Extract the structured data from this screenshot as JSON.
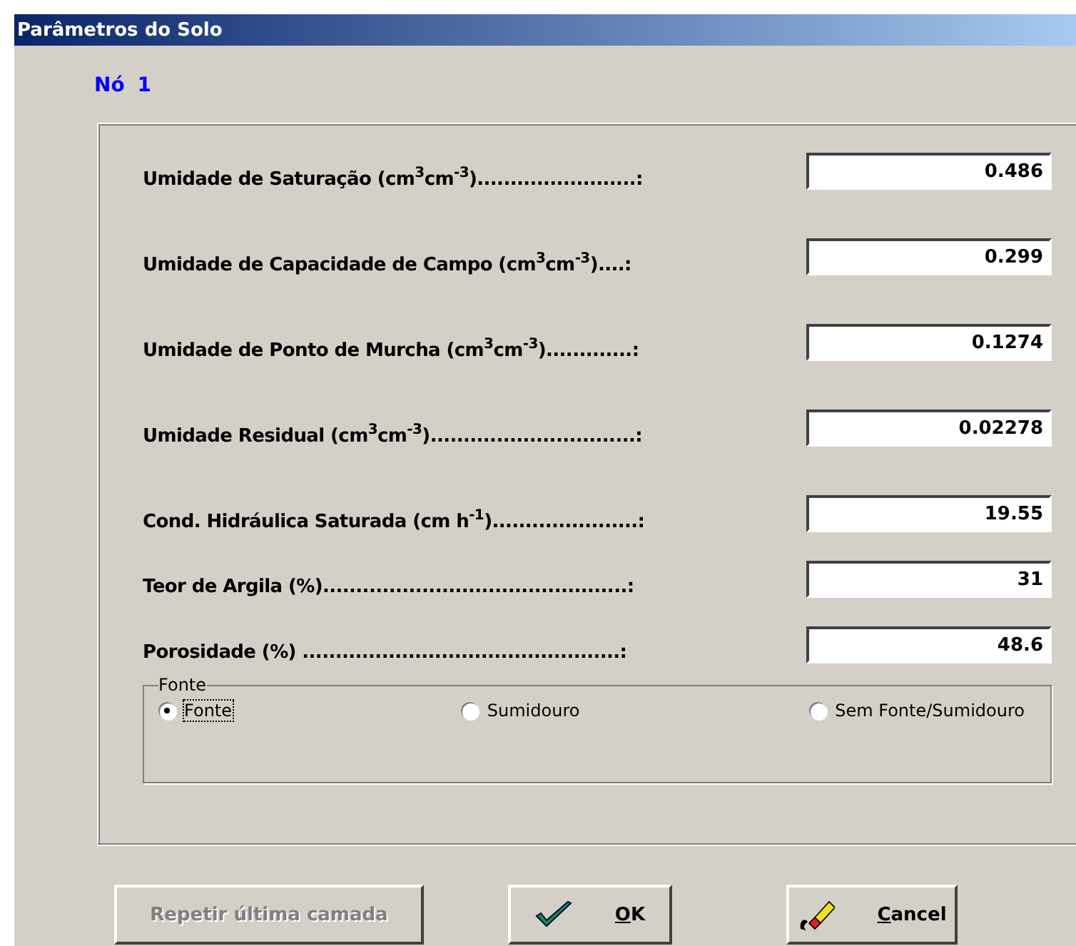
{
  "window": {
    "title": "Parâmetros do Solo"
  },
  "node_label": "Nó 1",
  "fields": [
    {
      "label": "Umidade de Saturação (cm$^{3}$cm$^{-3}$)........................:",
      "value": "0.486"
    },
    {
      "label": "Umidade de Capacidade de Campo (cm$^{3}$cm$^{-3}$)....:",
      "value": "0.299"
    },
    {
      "label": "Umidade de Ponto de Murcha (cm$^{3}$cm$^{-3}$).............:",
      "value": "0.1274"
    },
    {
      "label": "Umidade Residual (cm$^{3}$cm$^{-3}$)...............................:",
      "value": "0.02278"
    },
    {
      "label": "Cond. Hidráulica Saturada (cm h$^{-1}$)......................:",
      "value": "19.55"
    },
    {
      "label": "Teor de Argila (%)..............................................:",
      "value": "31"
    },
    {
      "label": "Porosidade (%) ................................................:",
      "value": "48.6"
    }
  ],
  "source_group": {
    "title": "Fonte",
    "options": [
      {
        "label": "Fonte",
        "selected": true
      },
      {
        "label": "Sumidouro",
        "selected": false
      },
      {
        "label": "Sem Fonte/Sumidouro",
        "selected": false
      }
    ]
  },
  "buttons": [
    {
      "kind": "plain",
      "label": "Repetir última camada",
      "disabled": true
    },
    {
      "kind": "ok",
      "label": "OK",
      "disabled": false
    },
    {
      "kind": "cancel",
      "label": "Cancel",
      "disabled": false
    }
  ]
}
